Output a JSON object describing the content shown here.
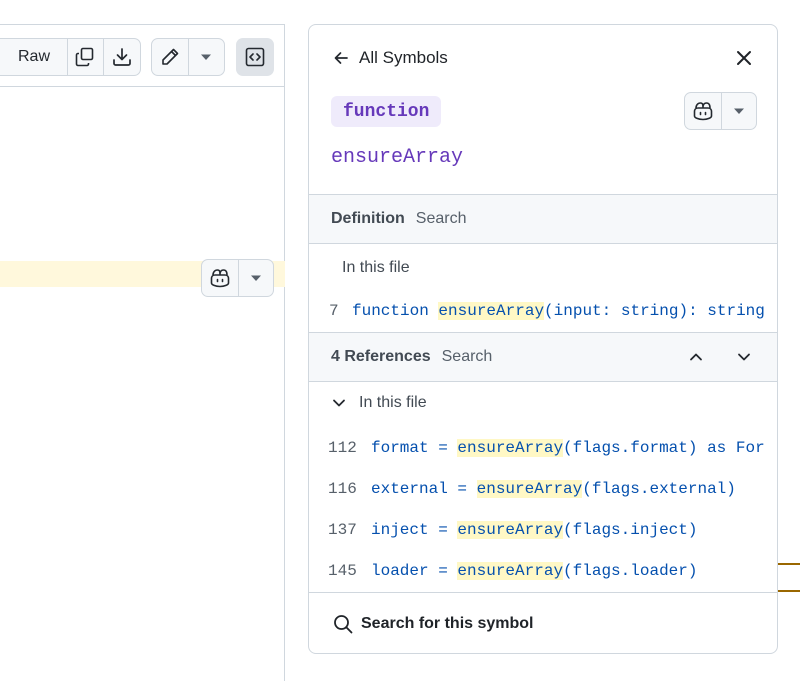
{
  "toolbar": {
    "raw_label": "Raw"
  },
  "symbols": {
    "back_label": "All Symbols",
    "kind": "function",
    "name": "ensureArray"
  },
  "definition": {
    "title": "Definition",
    "search_tab": "Search",
    "file_label": "In this file",
    "line": {
      "number": "7",
      "pre": "function ",
      "match": "ensureArray",
      "post": "(input: string): string"
    }
  },
  "references": {
    "title": "4 References",
    "search_tab": "Search",
    "file_label": "In this file",
    "rows": [
      {
        "number": "112",
        "pre": "format = ",
        "match": "ensureArray",
        "post": "(flags.format) as For"
      },
      {
        "number": "116",
        "pre": "external = ",
        "match": "ensureArray",
        "post": "(flags.external)"
      },
      {
        "number": "137",
        "pre": "inject = ",
        "match": "ensureArray",
        "post": "(flags.inject)"
      },
      {
        "number": "145",
        "pre": "loader = ",
        "match": "ensureArray",
        "post": "(flags.loader)"
      }
    ]
  },
  "footer": {
    "search_label": "Search for this symbol"
  },
  "icons": {
    "copy": "copy-icon",
    "download": "download-icon",
    "edit": "pencil-icon",
    "code": "code-square-icon",
    "copilot": "copilot-icon",
    "back": "arrow-left-icon",
    "close": "x-icon",
    "search": "search-icon"
  },
  "colors": {
    "accent_purple": "#6639ba",
    "badge_bg": "#efebfb",
    "code_blue": "#0550ae",
    "match_bg": "#fff8c5",
    "line_highlight": "#fff8dc"
  }
}
